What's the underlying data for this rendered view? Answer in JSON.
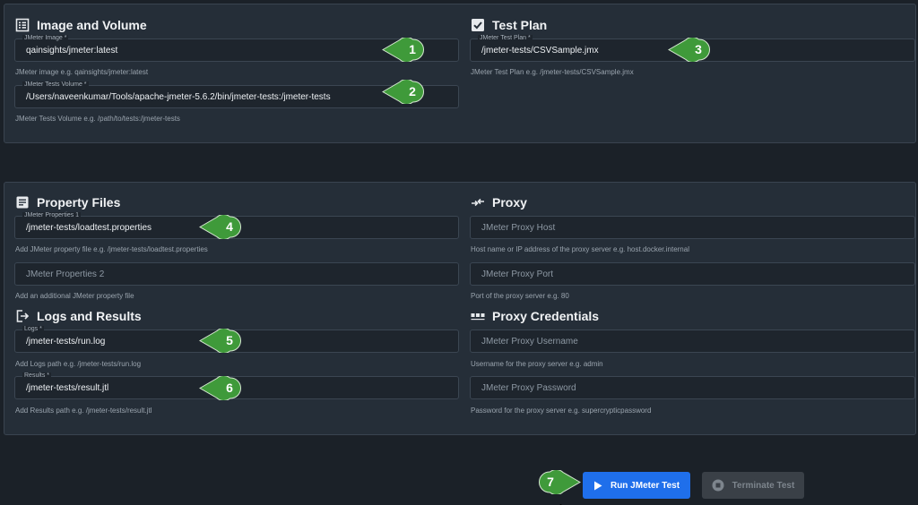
{
  "sections": {
    "image_volume": {
      "title": "Image and Volume"
    },
    "test_plan": {
      "title": "Test Plan"
    },
    "property_files": {
      "title": "Property Files"
    },
    "proxy": {
      "title": "Proxy"
    },
    "logs_results": {
      "title": "Logs and Results"
    },
    "proxy_credentials": {
      "title": "Proxy Credentials"
    }
  },
  "fields": {
    "image": {
      "label": "JMeter Image *",
      "value": "qainsights/jmeter:latest",
      "hint": "JMeter image e.g. qainsights/jmeter:latest"
    },
    "volume": {
      "label": "JMeter Tests Volume *",
      "value": "/Users/naveenkumar/Tools/apache-jmeter-5.6.2/bin/jmeter-tests:/jmeter-tests",
      "hint": "JMeter Tests Volume e.g. /path/to/tests:/jmeter-tests"
    },
    "test_plan": {
      "label": "JMeter Test Plan *",
      "value": "/jmeter-tests/CSVSample.jmx",
      "hint": "JMeter Test Plan e.g. /jmeter-tests/CSVSample.jmx"
    },
    "properties1": {
      "label": "JMeter Properties 1",
      "value": "/jmeter-tests/loadtest.properties",
      "hint": "Add JMeter property file e.g. /jmeter-tests/loadtest.properties"
    },
    "properties2": {
      "placeholder": "JMeter Properties 2",
      "hint": "Add an additional JMeter property file"
    },
    "proxy_host": {
      "placeholder": "JMeter Proxy Host",
      "hint": "Host name or IP address of the proxy server e.g. host.docker.internal"
    },
    "proxy_port": {
      "placeholder": "JMeter Proxy Port",
      "hint": "Port of the proxy server e.g. 80"
    },
    "logs": {
      "label": "Logs *",
      "value": "/jmeter-tests/run.log",
      "hint": "Add Logs path e.g. /jmeter-tests/run.log"
    },
    "results": {
      "label": "Results *",
      "value": "/jmeter-tests/result.jtl",
      "hint": "Add Results path e.g. /jmeter-tests/result.jtl"
    },
    "proxy_username": {
      "placeholder": "JMeter Proxy Username",
      "hint": "Username for the proxy server e.g. admin"
    },
    "proxy_password": {
      "placeholder": "JMeter Proxy Password",
      "hint": "Password for the proxy server e.g. supercrypticpassword"
    }
  },
  "badges": [
    "1",
    "2",
    "3",
    "4",
    "5",
    "6",
    "7"
  ],
  "buttons": {
    "run": "Run JMeter Test",
    "terminate": "Terminate Test"
  },
  "colors": {
    "background": "#1b2128",
    "panel": "#252e38",
    "badge": "#3f9a3a",
    "primary": "#1f6feb",
    "disabled": "#3a4047"
  },
  "icons": {
    "image_volume": "list-icon",
    "test_plan": "checkbox-icon",
    "property_files": "document-icon",
    "proxy": "swap-icon",
    "logs_results": "logout-icon",
    "proxy_credentials": "password-dots-icon",
    "run": "play-icon",
    "terminate": "stop-icon"
  }
}
